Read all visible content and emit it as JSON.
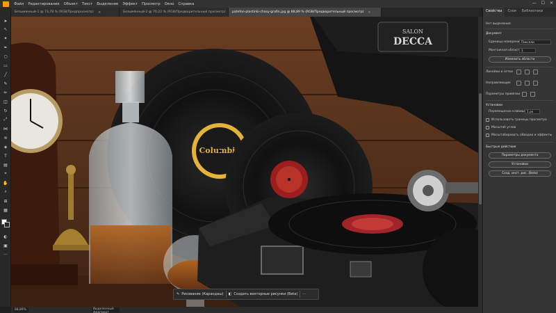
{
  "menu": {
    "items": [
      "Файл",
      "Редактирование",
      "Объект",
      "Текст",
      "Выделение",
      "Эффект",
      "Просмотр",
      "Окно",
      "Справка"
    ]
  },
  "tabs": [
    {
      "label": "Безымянный-1 @ 73,78 % (RGB/Предпросмотр)",
      "active": false
    },
    {
      "label": "Безымянный-2 @ 70,22 % (RGB/Предварительный просмотр)",
      "active": false
    },
    {
      "label": "patefon-plastinki-chasy-grafin.jpg @ 88,89 % (RGB/Предварительный просмотр)",
      "active": true
    }
  ],
  "canvas": {
    "decca_brand": "DECCA",
    "decca_salon": "SALON",
    "columbia_label": "Columbia"
  },
  "taskbar": {
    "draw_label": "Рисование (Карандаш)",
    "vector_label": "Создать векторные рисунки (Beta)",
    "more": "···"
  },
  "status": {
    "zoom": "88,89%",
    "tool": "Выделенный фрагмент"
  },
  "panel": {
    "tabs": [
      "Свойства",
      "Слои",
      "Библиотеки"
    ],
    "no_selection": "Нет выделения",
    "document": "Документ",
    "units_label": "Единицы измерения:",
    "units_value": "Пиксели",
    "artboard_label": "Монтажная область:",
    "artboard_value": "1",
    "edit_artboards": "Изменить области",
    "rulers_grids": "Линейки и сетки",
    "guides": "Направляющие",
    "snap_options": "Параметры привязки",
    "preferences": "Установки",
    "keyboard_increment_label": "Перемещение клавишами:",
    "keyboard_increment_value": "1 px",
    "checks": [
      "Использовать границы просмотра",
      "Масштаб углов",
      "Масштабировать обводки и эффекты"
    ],
    "quick_actions": "Быстрые действия",
    "doc_setup": "Параметры документа",
    "preferences_btn": "Установки",
    "bg_button": "Созд. инст. рис. (Beta)"
  },
  "colors": {
    "accent": "#ff9a00",
    "ui_bg": "#1e1e1e",
    "panel_bg": "#353535",
    "wood": "#5a3420"
  }
}
